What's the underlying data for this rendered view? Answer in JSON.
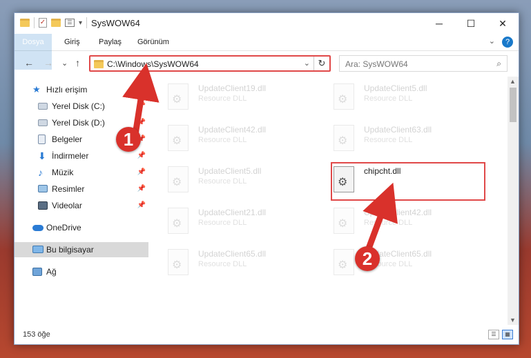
{
  "window": {
    "title": "SysWOW64",
    "minimize_glyph": "─",
    "maximize_glyph": "☐",
    "close_glyph": "✕",
    "toolbar_dropdown_glyph": "▾"
  },
  "ribbon": {
    "tabs": [
      "Dosya",
      "Giriş",
      "Paylaş",
      "Görünüm"
    ],
    "expand_glyph": "⌄",
    "help_glyph": "?"
  },
  "navbar": {
    "back": "←",
    "forward": "→",
    "recent": "⌄",
    "up": "↑",
    "address": "C:\\Windows\\SysWOW64",
    "address_dropdown": "⌄",
    "refresh": "↻",
    "search_placeholder": "Ara: SysWOW64",
    "search_icon": "⌕"
  },
  "sidebar": {
    "items": [
      {
        "label": "Hızlı erişim",
        "icon": "star-icon",
        "pinned": false
      },
      {
        "label": "Yerel Disk (C:)",
        "icon": "drive-icon",
        "pinned": true
      },
      {
        "label": "Yerel Disk (D:)",
        "icon": "drive-icon",
        "pinned": true
      },
      {
        "label": "Belgeler",
        "icon": "documents-icon",
        "pinned": true
      },
      {
        "label": "İndirmeler",
        "icon": "download-icon",
        "pinned": true
      },
      {
        "label": "Müzik",
        "icon": "music-icon",
        "pinned": true
      },
      {
        "label": "Resimler",
        "icon": "pictures-icon",
        "pinned": true
      },
      {
        "label": "Videolar",
        "icon": "videos-icon",
        "pinned": true
      },
      {
        "label": "OneDrive",
        "icon": "cloud-icon",
        "pinned": false
      },
      {
        "label": "Bu bilgisayar",
        "icon": "computer-icon",
        "pinned": false
      },
      {
        "label": "Ağ",
        "icon": "network-icon",
        "pinned": false
      }
    ],
    "pin_glyph": "📌"
  },
  "files": [
    {
      "name": "UpdateClient19.dll",
      "desc": "Resource DLL"
    },
    {
      "name": "UpdateClient5.dll",
      "desc": "Resource DLL"
    },
    {
      "name": "UpdateClient42.dll",
      "desc": "Resource DLL"
    },
    {
      "name": "UpdateClient63.dll",
      "desc": "Resource DLL"
    },
    {
      "name": "UpdateClient5.dll",
      "desc": "Resource DLL"
    },
    {
      "name": "chipcht.dll",
      "desc": ""
    },
    {
      "name": "UpdateClient21.dll",
      "desc": "Resource DLL"
    },
    {
      "name": "UpdateClient42.dll",
      "desc": "Resource DLL"
    },
    {
      "name": "UpdateClient65.dll",
      "desc": "Resource DLL"
    },
    {
      "name": "UpdateClient65.dll",
      "desc": "Resource DLL"
    }
  ],
  "status": {
    "item_count": "153 öğe"
  },
  "markers": [
    "1",
    "2"
  ],
  "colors": {
    "accent": "#1979ca",
    "highlight": "#e04848",
    "marker": "#d9312b"
  }
}
